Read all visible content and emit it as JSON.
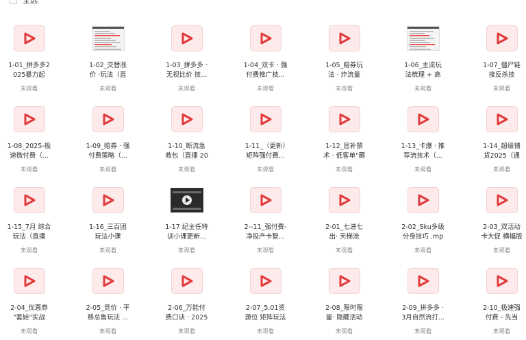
{
  "header": {
    "select_all_label": "全选"
  },
  "colors": {
    "video_icon_bg": "#fdeaea",
    "video_icon_play": "#e23b3b",
    "status_text": "#8a8a8a"
  },
  "items": [
    {
      "title": "1-01_拼多多2025暴力起店...",
      "status": "未观看",
      "icon": "video-icon"
    },
    {
      "title": "1-02_交替涨价 ·玩法（直播...",
      "status": "未观看",
      "icon": "screenshot-thumbnail"
    },
    {
      "title": "1-03_拼多多 · 无视比价 技...",
      "status": "未观看",
      "icon": "video-icon"
    },
    {
      "title": "1-04_双卡 · 强付费推广技...",
      "status": "未观看",
      "icon": "video-icon"
    },
    {
      "title": "1-05_赔券玩法 · 炸流量（视...",
      "status": "未观看",
      "icon": "video-icon"
    },
    {
      "title": "1-06_主流玩法梳理 + 高频...",
      "status": "未观看",
      "icon": "screenshot-thumbnail"
    },
    {
      "title": "1-07_僵尸链接反杀技（直...",
      "status": "未观看",
      "icon": "video-icon"
    },
    {
      "title": "1-08_2025-极速微付费（...",
      "status": "未观看",
      "icon": "video-icon"
    },
    {
      "title": "1-09_赔券 · 强付费策略（...",
      "status": "未观看",
      "icon": "video-icon"
    },
    {
      "title": "1-10_断流急救包（直播 202...",
      "status": "未观看",
      "icon": "video-icon"
    },
    {
      "title": "1-11_（更新）矩阵强付费...",
      "status": "未观看",
      "icon": "video-icon"
    },
    {
      "title": "1-12_官补禁术 · 低客单\"薅补...",
      "status": "未观看",
      "icon": "video-icon"
    },
    {
      "title": "1-13_卡爆 · 推荐流技术（...",
      "status": "未观看",
      "icon": "video-icon"
    },
    {
      "title": "1-14_超级铺货2025（通用...",
      "status": "未观看",
      "icon": "video-icon"
    },
    {
      "title": "1-15_7月 综合玩法（直播 2...",
      "status": "未观看",
      "icon": "video-icon"
    },
    {
      "title": "1-16_三百团玩法小课（直...",
      "status": "未观看",
      "icon": "video-icon"
    },
    {
      "title": "1-17 纪主任特训小课更新...",
      "status": "未观看",
      "icon": "video-thumbnail"
    },
    {
      "title": "2--11_强付费-净投产卡智...",
      "status": "未观看",
      "icon": "video-icon"
    },
    {
      "title": "2-01_七进七出· 天梯流（视...",
      "status": "未观看",
      "icon": "video-icon"
    },
    {
      "title": "2-02_Sku多级分身技巧 .mp4",
      "status": "未观看",
      "icon": "video-icon"
    },
    {
      "title": "2-03_双活动卡大促 横幅版 ...",
      "status": "未观看",
      "icon": "video-icon"
    },
    {
      "title": "2-04_优惠券 \"套娃\"实战课...",
      "status": "未观看",
      "icon": "video-icon"
    },
    {
      "title": "2-05_竞价 · 平移总售玩法 ...",
      "status": "未观看",
      "icon": "video-icon"
    },
    {
      "title": "2-06_万能付费口诀 · 2025 ...",
      "status": "未观看",
      "icon": "video-icon"
    },
    {
      "title": "2-07_5.01资源位 矩阵玩法 ...",
      "status": "未观看",
      "icon": "video-icon"
    },
    {
      "title": "2-08_限时限量· 隐藏活动玩...",
      "status": "未观看",
      "icon": "video-icon"
    },
    {
      "title": "2-09_拼多多 · 3月自然流打...",
      "status": "未观看",
      "icon": "video-icon"
    },
    {
      "title": "2-10_极速强付费 - 先当孙...",
      "status": "未观看",
      "icon": "video-icon"
    }
  ]
}
